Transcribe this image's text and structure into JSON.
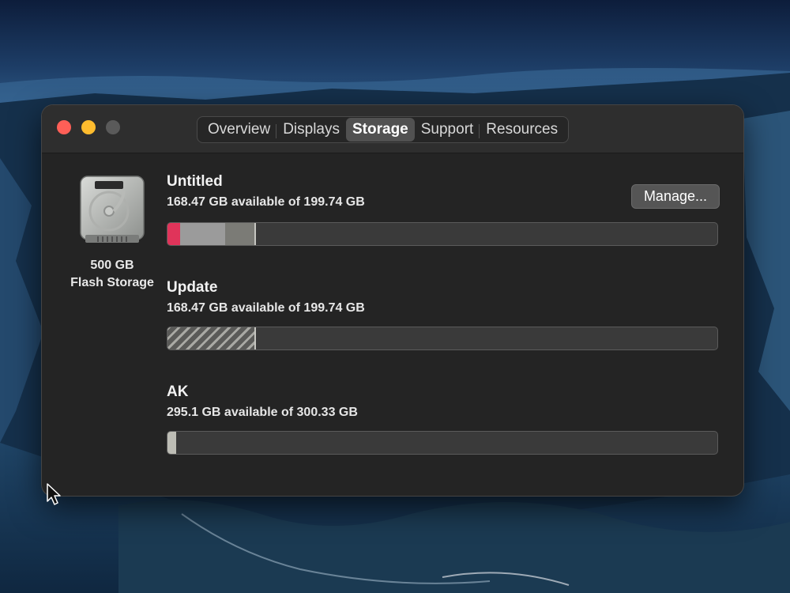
{
  "window": {
    "tabs": [
      {
        "label": "Overview",
        "active": false
      },
      {
        "label": "Displays",
        "active": false
      },
      {
        "label": "Storage",
        "active": true
      },
      {
        "label": "Support",
        "active": false
      },
      {
        "label": "Resources",
        "active": false
      }
    ]
  },
  "disk": {
    "icon": "hard-drive-icon",
    "capacity": "500 GB",
    "type": "Flash Storage"
  },
  "manage_button": {
    "label": "Manage..."
  },
  "volumes": [
    {
      "name": "Untitled",
      "availability": "168.47 GB available of 199.74 GB",
      "used_fraction": 0.157,
      "segments": [
        {
          "fraction": 0.022,
          "color": "#e0345a"
        },
        {
          "fraction": 0.081,
          "color": "#9b9b9b"
        },
        {
          "fraction": 0.054,
          "color": "#7b7b76"
        }
      ]
    },
    {
      "name": "Update",
      "availability": "168.47 GB available of 199.74 GB",
      "used_fraction": 0.157,
      "segments": [
        {
          "fraction": 0.157,
          "color": "striped"
        }
      ]
    },
    {
      "name": "AK",
      "availability": "295.1 GB available of 300.33 GB",
      "used_fraction": 0.017,
      "segments": [
        {
          "fraction": 0.017,
          "color": "#bdbdb5"
        }
      ]
    }
  ],
  "colors": {
    "close": "#ff5f57",
    "minimize": "#febc2e",
    "zoom_disabled": "#5a5a5a"
  }
}
